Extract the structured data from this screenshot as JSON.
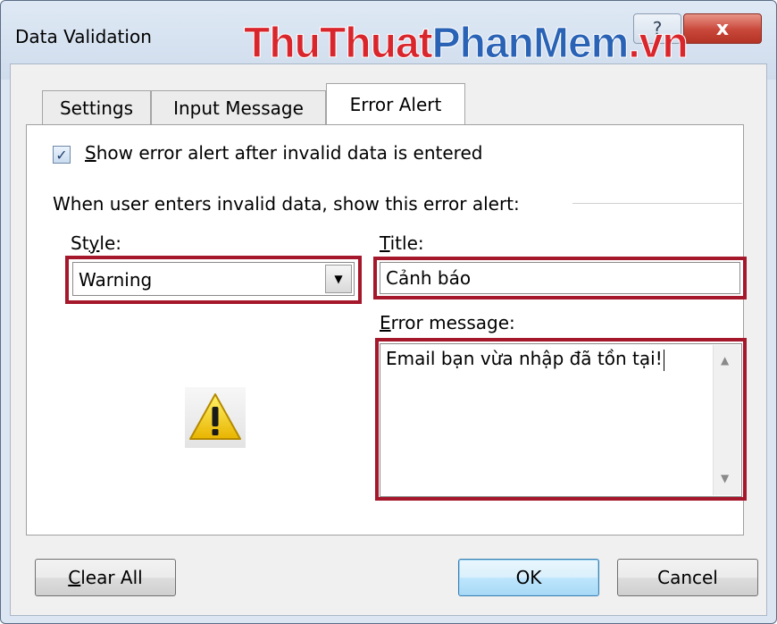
{
  "window": {
    "title": "Data Validation",
    "help_glyph": "?",
    "close_glyph": "x"
  },
  "watermark": {
    "part1": "ThuThuat",
    "part2": "PhanMem",
    "part3": ".vn"
  },
  "tabs": [
    {
      "label": "Settings",
      "active": false
    },
    {
      "label": "Input Message",
      "active": false
    },
    {
      "label": "Error Alert",
      "active": true
    }
  ],
  "error_alert": {
    "show_checkbox": {
      "checked": true,
      "label_mnemonic": "S",
      "label_rest": "how error alert after invalid data is entered"
    },
    "group_caption": "When user enters invalid data, show this error alert:",
    "style": {
      "label_pre": "St",
      "label_mnemonic": "y",
      "label_post": "le:",
      "value": "Warning"
    },
    "title": {
      "label_mnemonic": "T",
      "label_rest": "itle:",
      "value": "Cảnh báo"
    },
    "error_message": {
      "label_mnemonic": "E",
      "label_rest": "rror message:",
      "value": "Email bạn vừa nhập đã tồn tại!"
    },
    "icon": "warning-icon"
  },
  "buttons": {
    "clear_all_mnemonic": "C",
    "clear_all_rest": "lear All",
    "ok": "OK",
    "cancel": "Cancel"
  },
  "colors": {
    "highlight_box": "#a5172a",
    "watermark_red": "#d8262c",
    "watermark_blue": "#2a63b6",
    "close_button": "#c8473a"
  }
}
